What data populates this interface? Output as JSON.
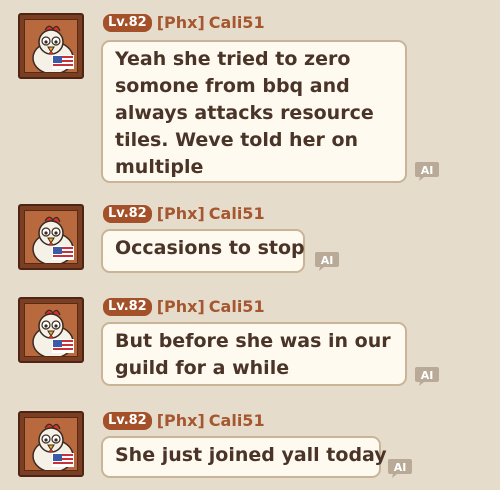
{
  "messages": [
    {
      "level": "Lv.82",
      "guild": "[Phx]",
      "name": "Cali51",
      "lines": [
        "Yeah she tried to zero",
        "somone from bbq and",
        "always attacks resource",
        "tiles. Weve told her on",
        "multiple"
      ]
    },
    {
      "level": "Lv.82",
      "guild": "[Phx]",
      "name": "Cali51",
      "lines": [
        "Occasions to stop"
      ]
    },
    {
      "level": "Lv.82",
      "guild": "[Phx]",
      "name": "Cali51",
      "lines": [
        "But before she was in our",
        "guild for a while"
      ]
    },
    {
      "level": "Lv.82",
      "guild": "[Phx]",
      "name": "Cali51",
      "lines": [
        "She just joined yall today"
      ]
    }
  ],
  "translate_icon_label": "AI",
  "colors": {
    "background": "#e6dccc",
    "bubble": "#fffaf0",
    "bubble_border": "#c9b497",
    "level_badge": "#a45029",
    "name_text": "#a55730",
    "message_text": "#4a3428"
  }
}
